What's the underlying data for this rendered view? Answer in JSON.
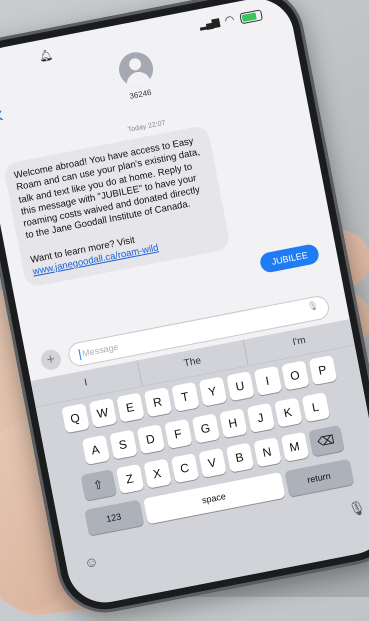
{
  "contact": {
    "name": "36246"
  },
  "conversation": {
    "timestamp": "Today 22:07",
    "incoming_paragraph": "Welcome abroad! You have access to Easy Roam and can use your plan's existing data, talk and text like you do at home. Reply to this message with \"JUBILEE\" to have your roaming costs waived and donated directly to the Jane Goodall Institute of Canada.",
    "learn_more": "Want to learn more? Visit",
    "link": "www.janegoodall.ca/roam-wild",
    "outgoing_message": "JUBILEE"
  },
  "compose": {
    "placeholder": "Message",
    "plus": "+"
  },
  "keyboard": {
    "suggestions": [
      "I",
      "The",
      "I'm"
    ],
    "row1": [
      "Q",
      "W",
      "E",
      "R",
      "T",
      "Y",
      "U",
      "I",
      "O",
      "P"
    ],
    "row2": [
      "A",
      "S",
      "D",
      "F",
      "G",
      "H",
      "J",
      "K",
      "L"
    ],
    "row3": [
      "Z",
      "X",
      "C",
      "V",
      "B",
      "N",
      "M"
    ],
    "numbers_label": "123",
    "space_label": "space",
    "return_label": "return"
  },
  "colors": {
    "accent": "#1f7cf5",
    "bubble_incoming": "#e5e5ea"
  },
  "icons": [
    "bell-icon",
    "signal-icon",
    "wifi-icon",
    "battery-icon",
    "back-icon",
    "avatar",
    "mic-icon",
    "shift-icon",
    "delete-icon",
    "emoji-icon"
  ]
}
